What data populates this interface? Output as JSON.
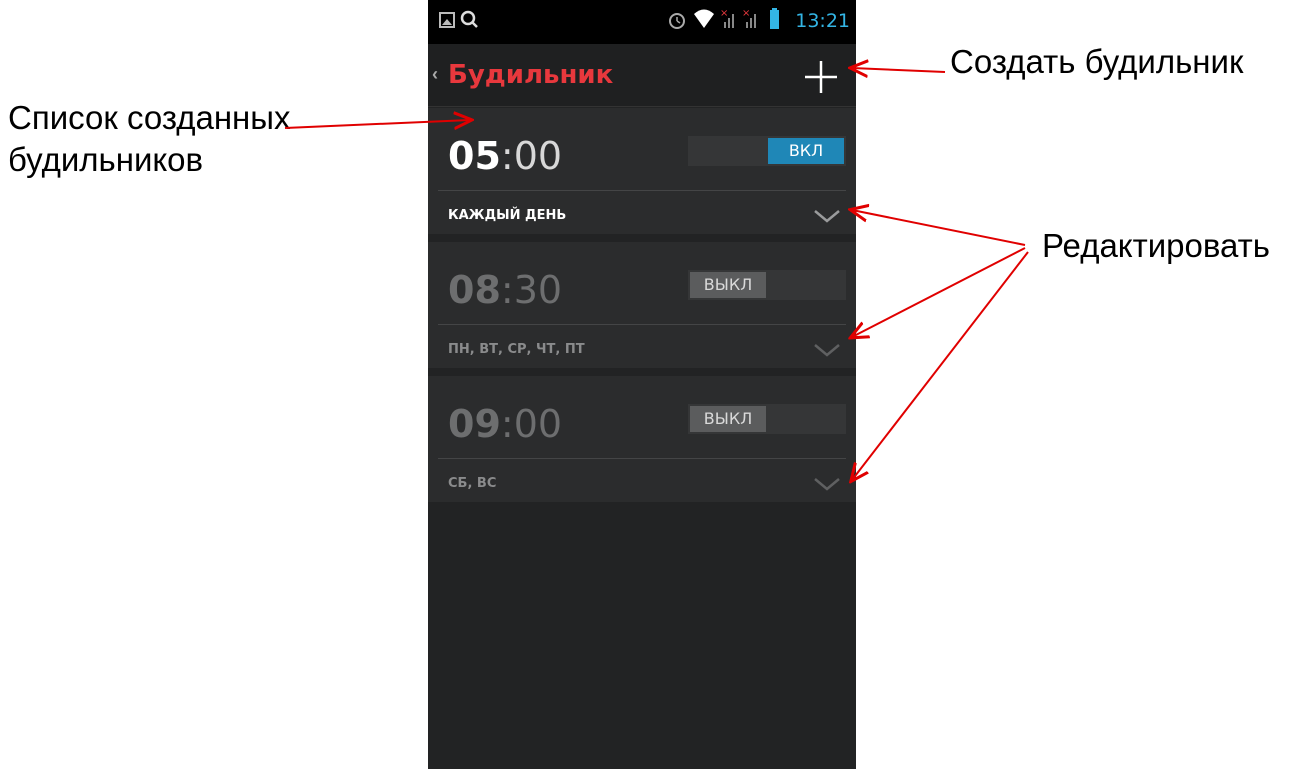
{
  "statusbar": {
    "time": "13:21"
  },
  "actionbar": {
    "back": "‹",
    "title": "Будильник",
    "add_icon": "plus-icon"
  },
  "alarms": [
    {
      "hour": "05",
      "minute": ":00",
      "toggle": "ВКЛ",
      "days": "КАЖДЫЙ ДЕНЬ",
      "enabled": true
    },
    {
      "hour": "08",
      "minute": ":30",
      "toggle": "ВЫКЛ",
      "days": "ПН, ВТ, СР, ЧТ, ПТ",
      "enabled": false
    },
    {
      "hour": "09",
      "minute": ":00",
      "toggle": "ВЫКЛ",
      "days": "СБ, ВС",
      "enabled": false
    }
  ],
  "annotations": {
    "create": "Создать будильник",
    "list_line1": "Список созданных",
    "list_line2": "будильников",
    "edit": "Редактировать"
  },
  "colors": {
    "accent_red": "#e8383d",
    "toggle_on": "#1f87b7",
    "clock_blue": "#33b5e5",
    "arrow_red": "#e00000"
  }
}
